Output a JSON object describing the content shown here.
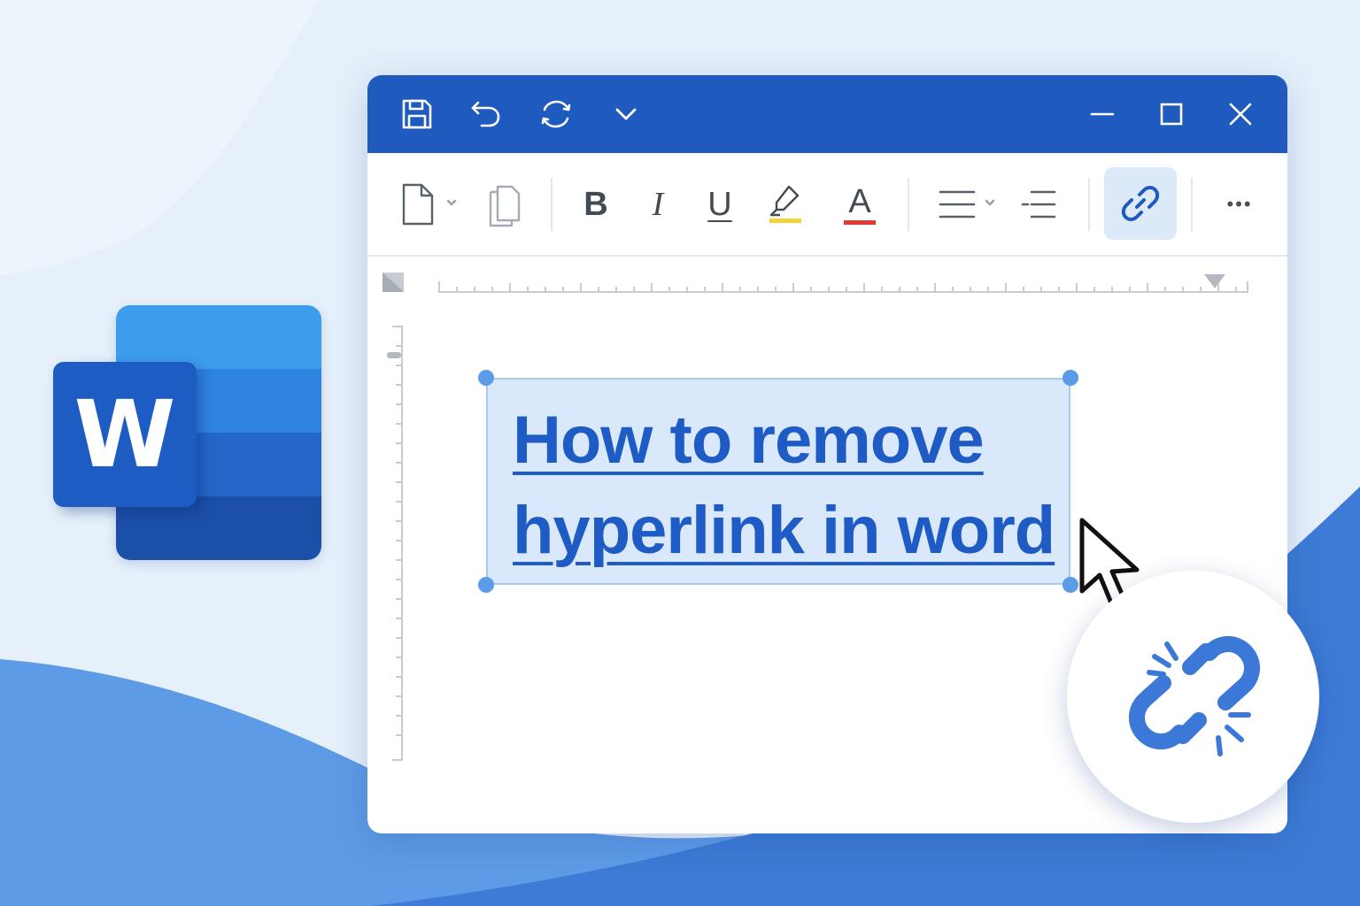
{
  "document": {
    "headline_line1": "How to remove",
    "headline_line2": "hyperlink in word"
  },
  "logo": {
    "letter": "W"
  },
  "toolbar": {
    "bold": "B",
    "italic": "I",
    "underline": "U",
    "font_color": "A",
    "more": "•••"
  },
  "icons": {
    "quick_access": [
      "save-icon",
      "undo-icon",
      "redo-icon",
      "customize-dropdown-icon"
    ],
    "window_controls": [
      "minimize-icon",
      "maximize-icon",
      "close-icon"
    ],
    "ribbon": [
      "new-document-icon",
      "copy-document-icon",
      "bold-icon",
      "italic-icon",
      "underline-icon",
      "highlighter-icon",
      "font-color-icon",
      "align-icon",
      "list-icon",
      "link-icon",
      "more-icon"
    ],
    "overlay": [
      "mouse-pointer-icon",
      "broken-link-icon"
    ]
  },
  "colors": {
    "titlebar": "#1f5bbf",
    "link_text": "#1f5bc4",
    "selection": "#d9e8fa",
    "highlight_yellow": "#f4d33a",
    "font_color_red": "#e53935",
    "word_blue": "#1d5cc2"
  }
}
